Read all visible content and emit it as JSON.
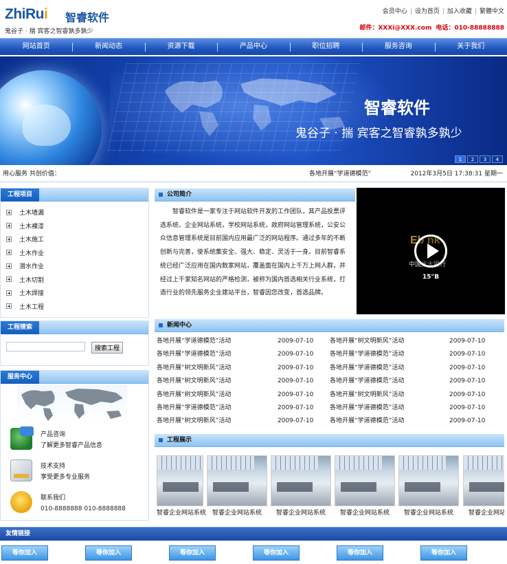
{
  "header": {
    "logo_en_part1": "ZhiRu",
    "logo_en_part2": "i",
    "logo_cn": "智睿软件",
    "logo_sub": "鬼谷子 · 揣  宾客之智睿孰多孰少",
    "top_links": [
      "会员中心",
      "设为首页",
      "加入收藏",
      "繁體中文"
    ],
    "contact_mail": "邮件：XXXi@XXX.com",
    "contact_phone": "电话：010-88888888"
  },
  "nav": {
    "items": [
      "网站首页",
      "新闻动态",
      "资源下载",
      "产品中心",
      "职位招聘",
      "服务咨询",
      "关于我们"
    ]
  },
  "banner": {
    "title": "智睿软件",
    "slogan": "鬼谷子 · 揣  宾客之智睿孰多孰少",
    "pages": [
      "1",
      "2",
      "3",
      "4"
    ],
    "active_page": "1"
  },
  "ticker": {
    "left": "用心服务 共创价值：",
    "news": "各地开展“学道德模范”",
    "datetime": "2012年3月5日 17:38:31 星期一"
  },
  "projects": {
    "title": "工程项目",
    "items": [
      "土木墙漏",
      "土木裸漆",
      "土木施工",
      "土木作业",
      "潜水作业",
      "土木切割",
      "土木焊接",
      "土木工程"
    ]
  },
  "project_search": {
    "title": "工程搜索",
    "input_value": "",
    "button": "搜索工程"
  },
  "service": {
    "title": "服务中心",
    "items": [
      {
        "title": "产品咨询",
        "desc": "了解更多智睿产品信息"
      },
      {
        "title": "技术支持",
        "desc": "享受更多专业服务"
      },
      {
        "title": "联系我们",
        "desc": "010-8888888 010-8888888"
      }
    ]
  },
  "company": {
    "title": "公司简介",
    "intro": "智睿软件是一家专注于网站软件开发的工作团队，其产品投票评选系统、企业网站系统，学校网站系统，政府网站管理系统，公安公众信息管理系统是目前国内应用最广泛的网站程序。通过多年的不断创新与完善，使系统集安全、强大、稳定、灵活于一身。目前智睿系统已经广泛应用在国内数家网站，覆盖面在国内上千万上网人群，并经过上千家知名网站的严格检测，被称为国内首选相关行业系统，打造行业的领先服务企业建站平台，智睿因您改变，首选品牌。"
  },
  "video": {
    "logo_text": "Eb nk",
    "bank_text": "中国光大银行",
    "duration": "15\"B"
  },
  "news": {
    "title": "新闻中心",
    "rows": [
      {
        "a": "各地开展“学道德模范”活动",
        "ad": "2009-07-10",
        "b": "各地开展“树文明新风”活动",
        "bd": "2009-07-10"
      },
      {
        "a": "各地开展“学道德模范”活动",
        "ad": "2009-07-10",
        "b": "各地开展“学道德模范”活动",
        "bd": "2009-07-10"
      },
      {
        "a": "各地开展“树文明新风”活动",
        "ad": "2009-07-10",
        "b": "各地开展“学道德模范”活动",
        "bd": "2009-07-10"
      },
      {
        "a": "各地开展“树文明新风”活动",
        "ad": "2009-07-10",
        "b": "各地开展“学道德模范”活动",
        "bd": "2009-07-10"
      },
      {
        "a": "各地开展“树文明新风”活动",
        "ad": "2009-07-10",
        "b": "各地开展“树文明新风”活动",
        "bd": "2009-07-10"
      },
      {
        "a": "各地开展“学道德模范”活动",
        "ad": "2009-07-10",
        "b": "各地开展“学道德模范”活动",
        "bd": "2009-07-10"
      },
      {
        "a": "各地开展“树文明新风”活动",
        "ad": "2009-07-10",
        "b": "各地开展“学道德模范”活动",
        "bd": "2009-07-10"
      }
    ]
  },
  "showcase": {
    "title": "工程展示",
    "items": [
      "智睿企业网站系统",
      "智睿企业网站系统",
      "智睿企业网站系统",
      "智睿企业网站系统",
      "智睿企业网站系统",
      "智睿企业网站系统"
    ]
  },
  "friend_links": {
    "title": "友情链接",
    "items": [
      "等你加入",
      "等你加入",
      "等你加入",
      "等你加入",
      "等你加入",
      "等你加入"
    ]
  },
  "colors": {
    "brand_blue": "#1a55a8",
    "brand_orange": "#f39a18",
    "nav_blue": "#1f56bf",
    "contact_red": "#d8000c"
  }
}
